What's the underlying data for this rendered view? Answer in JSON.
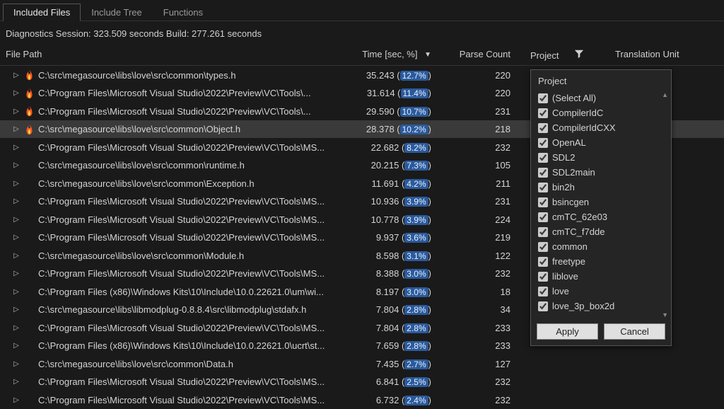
{
  "tabs": {
    "items": [
      {
        "label": "Included Files",
        "active": true
      },
      {
        "label": "Include Tree",
        "active": false
      },
      {
        "label": "Functions",
        "active": false
      }
    ]
  },
  "session": {
    "text": "Diagnostics Session: 323.509 seconds  Build: 277.261 seconds"
  },
  "columns": {
    "path": "File Path",
    "time": "Time [sec, %]",
    "parse": "Parse Count",
    "project": "Project",
    "translation": "Translation Unit"
  },
  "rows": [
    {
      "path": "C:\\src\\megasource\\libs\\love\\src\\common\\types.h",
      "time": "35.243",
      "pct": "12.7%",
      "parse": "220",
      "fire": true,
      "selected": false
    },
    {
      "path": "C:\\Program Files\\Microsoft Visual Studio\\2022\\Preview\\VC\\Tools\\...",
      "time": "31.614",
      "pct": "11.4%",
      "parse": "220",
      "fire": true,
      "selected": false
    },
    {
      "path": "C:\\Program Files\\Microsoft Visual Studio\\2022\\Preview\\VC\\Tools\\...",
      "time": "29.590",
      "pct": "10.7%",
      "parse": "231",
      "fire": true,
      "selected": false
    },
    {
      "path": "C:\\src\\megasource\\libs\\love\\src\\common\\Object.h",
      "time": "28.378",
      "pct": "10.2%",
      "parse": "218",
      "fire": true,
      "selected": true
    },
    {
      "path": "C:\\Program Files\\Microsoft Visual Studio\\2022\\Preview\\VC\\Tools\\MS...",
      "time": "22.682",
      "pct": "8.2%",
      "parse": "232",
      "fire": false,
      "selected": false
    },
    {
      "path": "C:\\src\\megasource\\libs\\love\\src\\common\\runtime.h",
      "time": "20.215",
      "pct": "7.3%",
      "parse": "105",
      "fire": false,
      "selected": false
    },
    {
      "path": "C:\\src\\megasource\\libs\\love\\src\\common\\Exception.h",
      "time": "11.691",
      "pct": "4.2%",
      "parse": "211",
      "fire": false,
      "selected": false
    },
    {
      "path": "C:\\Program Files\\Microsoft Visual Studio\\2022\\Preview\\VC\\Tools\\MS...",
      "time": "10.936",
      "pct": "3.9%",
      "parse": "231",
      "fire": false,
      "selected": false
    },
    {
      "path": "C:\\Program Files\\Microsoft Visual Studio\\2022\\Preview\\VC\\Tools\\MS...",
      "time": "10.778",
      "pct": "3.9%",
      "parse": "224",
      "fire": false,
      "selected": false
    },
    {
      "path": "C:\\Program Files\\Microsoft Visual Studio\\2022\\Preview\\VC\\Tools\\MS...",
      "time": "9.937",
      "pct": "3.6%",
      "parse": "219",
      "fire": false,
      "selected": false
    },
    {
      "path": "C:\\src\\megasource\\libs\\love\\src\\common\\Module.h",
      "time": "8.598",
      "pct": "3.1%",
      "parse": "122",
      "fire": false,
      "selected": false
    },
    {
      "path": "C:\\Program Files\\Microsoft Visual Studio\\2022\\Preview\\VC\\Tools\\MS...",
      "time": "8.388",
      "pct": "3.0%",
      "parse": "232",
      "fire": false,
      "selected": false
    },
    {
      "path": "C:\\Program Files (x86)\\Windows Kits\\10\\Include\\10.0.22621.0\\um\\wi...",
      "time": "8.197",
      "pct": "3.0%",
      "parse": "18",
      "fire": false,
      "selected": false
    },
    {
      "path": "C:\\src\\megasource\\libs\\libmodplug-0.8.8.4\\src\\libmodplug\\stdafx.h",
      "time": "7.804",
      "pct": "2.8%",
      "parse": "34",
      "fire": false,
      "selected": false
    },
    {
      "path": "C:\\Program Files\\Microsoft Visual Studio\\2022\\Preview\\VC\\Tools\\MS...",
      "time": "7.804",
      "pct": "2.8%",
      "parse": "233",
      "fire": false,
      "selected": false
    },
    {
      "path": "C:\\Program Files (x86)\\Windows Kits\\10\\Include\\10.0.22621.0\\ucrt\\st...",
      "time": "7.659",
      "pct": "2.8%",
      "parse": "233",
      "fire": false,
      "selected": false
    },
    {
      "path": "C:\\src\\megasource\\libs\\love\\src\\common\\Data.h",
      "time": "7.435",
      "pct": "2.7%",
      "parse": "127",
      "fire": false,
      "selected": false
    },
    {
      "path": "C:\\Program Files\\Microsoft Visual Studio\\2022\\Preview\\VC\\Tools\\MS...",
      "time": "6.841",
      "pct": "2.5%",
      "parse": "232",
      "fire": false,
      "selected": false
    },
    {
      "path": "C:\\Program Files\\Microsoft Visual Studio\\2022\\Preview\\VC\\Tools\\MS...",
      "time": "6.732",
      "pct": "2.4%",
      "parse": "232",
      "fire": false,
      "selected": false
    }
  ],
  "filter": {
    "title": "Project",
    "apply": "Apply",
    "cancel": "Cancel",
    "items": [
      "(Select All)",
      "CompilerIdC",
      "CompilerIdCXX",
      "OpenAL",
      "SDL2",
      "SDL2main",
      "bin2h",
      "bsincgen",
      "cmTC_62e03",
      "cmTC_f7dde",
      "common",
      "freetype",
      "liblove",
      "love",
      "love_3p_box2d"
    ]
  }
}
